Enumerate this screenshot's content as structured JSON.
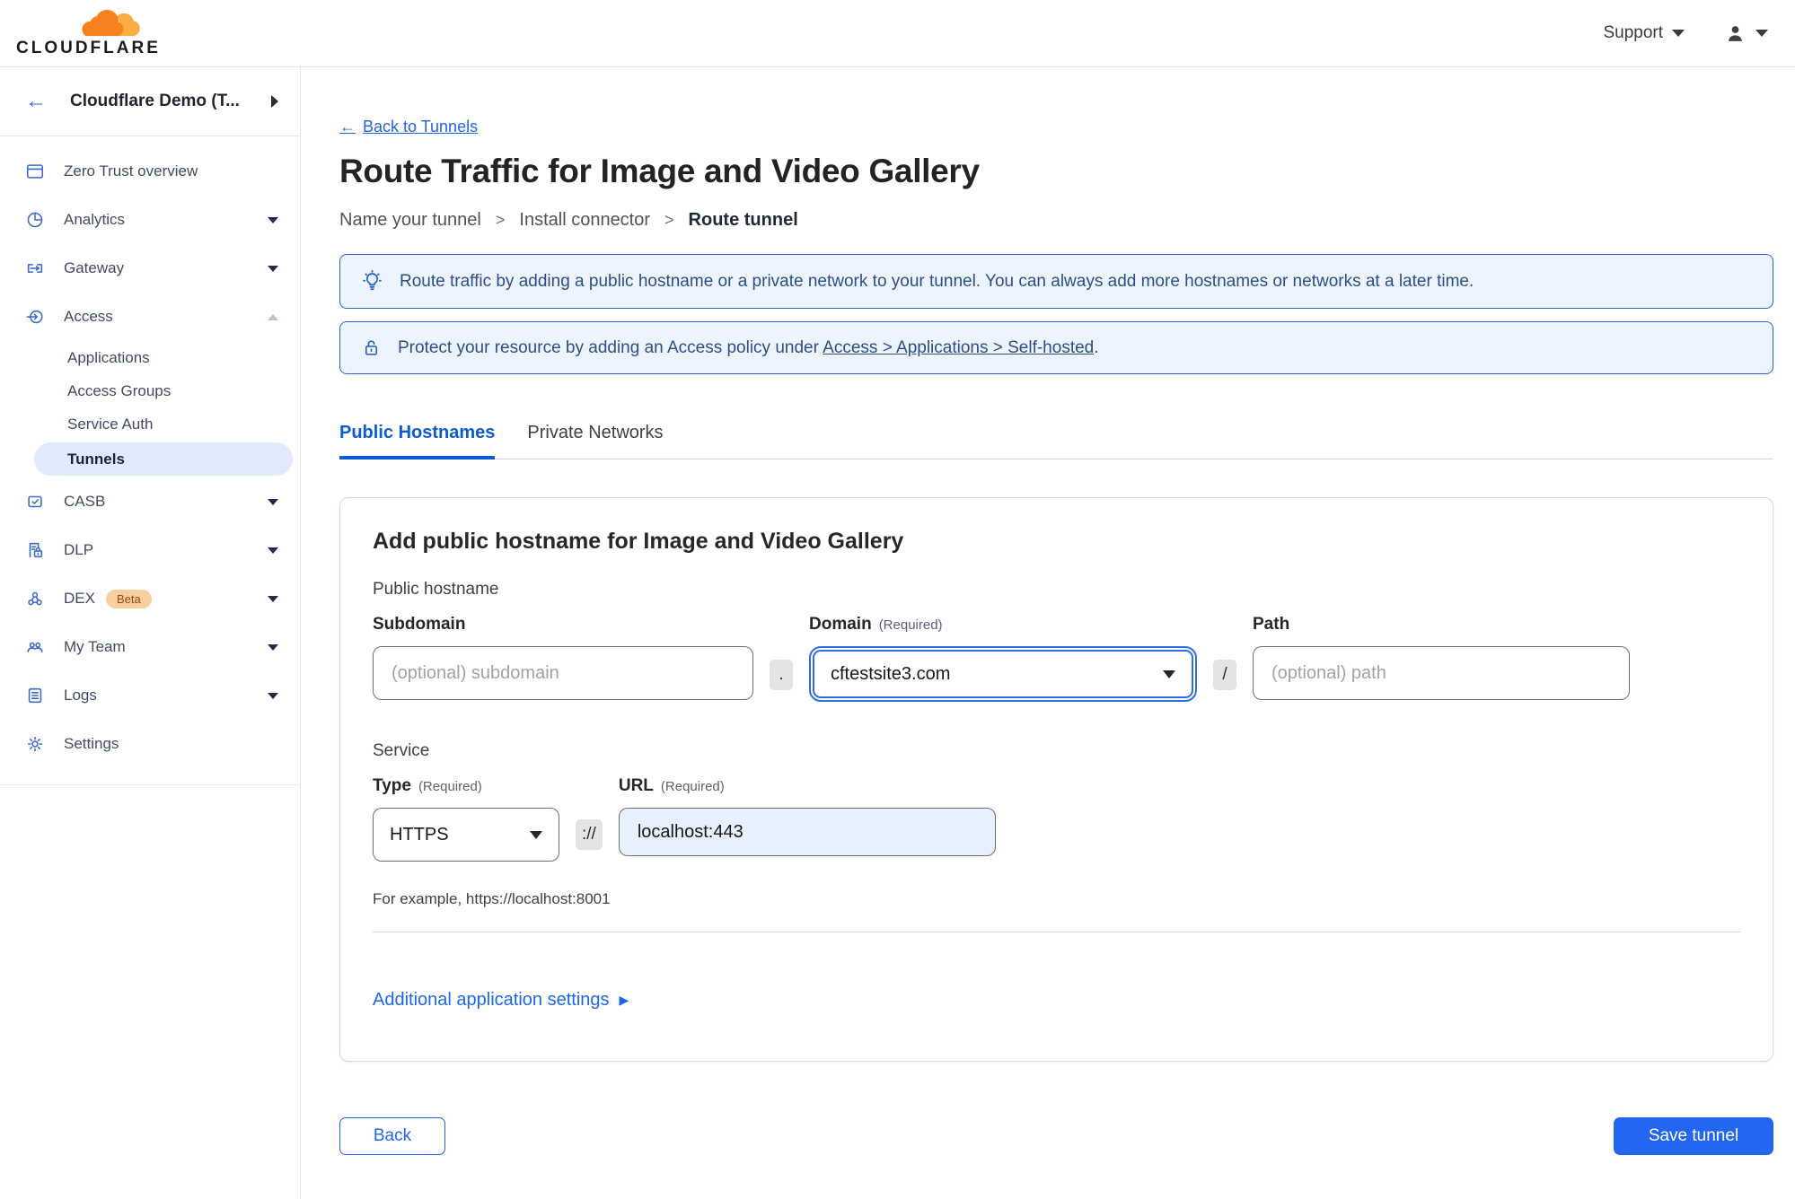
{
  "glyphs": {
    "arrow_left": "←",
    "back_arrow": "←",
    "step_sep": ">",
    "dot": ".",
    "slash": "/",
    "scheme": "://",
    "expander": "▶"
  },
  "header": {
    "logo_text": "CLOUDFLARE",
    "support_label": "Support"
  },
  "sidebar": {
    "account": "Cloudflare Demo (T...",
    "nav": [
      {
        "label": "Zero Trust overview"
      },
      {
        "label": "Analytics"
      },
      {
        "label": "Gateway"
      },
      {
        "label": "Access"
      },
      {
        "label": "CASB"
      },
      {
        "label": "DLP"
      },
      {
        "label": "DEX",
        "badge": "Beta"
      },
      {
        "label": "My Team"
      },
      {
        "label": "Logs"
      },
      {
        "label": "Settings"
      }
    ],
    "access_children": [
      {
        "label": "Applications"
      },
      {
        "label": "Access Groups"
      },
      {
        "label": "Service Auth"
      },
      {
        "label": "Tunnels"
      }
    ]
  },
  "main": {
    "back_link": "Back to Tunnels",
    "title": "Route Traffic for Image and Video Gallery",
    "steps": {
      "step1": "Name your tunnel",
      "step2": "Install connector",
      "step3": "Route tunnel"
    },
    "banner_tip": "Route traffic by adding a public hostname or a private network to your tunnel. You can always add more hostnames or networks at a later time.",
    "banner_protect_prefix": "Protect your resource by adding an Access policy under",
    "banner_protect_link": "Access > Applications > Self-hosted",
    "banner_protect_suffix": ".",
    "tabs": {
      "public": "Public Hostnames",
      "private": "Private Networks"
    },
    "card": {
      "title": "Add public hostname for Image and Video Gallery",
      "section_hostname": "Public hostname",
      "subdomain_label": "Subdomain",
      "subdomain_placeholder": "(optional) subdomain",
      "domain_label": "Domain",
      "required": "(Required)",
      "domain_value": "cftestsite3.com",
      "path_label": "Path",
      "path_placeholder": "(optional) path",
      "section_service": "Service",
      "type_label": "Type",
      "type_value": "HTTPS",
      "url_label": "URL",
      "url_value": "localhost:443",
      "example": "For example, https://localhost:8001",
      "additional_settings": "Additional application settings"
    },
    "footer": {
      "back": "Back",
      "save": "Save tunnel"
    }
  },
  "colors": {
    "accent_blue": "#2266f1",
    "tab_active": "#0b5cd2",
    "banner_border": "#2d63c8",
    "banner_bg": "#edf4fe",
    "sidebar_icon": "#3b68c9",
    "beta_badge_bg": "#f9cfa0"
  }
}
